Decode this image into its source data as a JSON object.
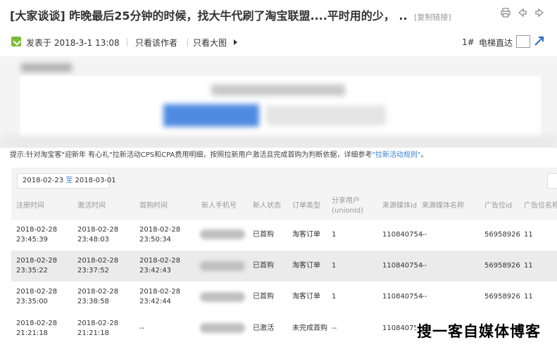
{
  "header": {
    "title_tag": "[大家谈谈]",
    "title": "昨晚最后25分钟的时候，找大牛代刷了淘宝联盟....平时用的少，",
    "title_ellipsis": "..",
    "copy_link": "[复制链接]",
    "icons": [
      "print-icon",
      "prev-icon",
      "next-icon"
    ]
  },
  "meta": {
    "posted": "发表于 2018-3-1 13:08",
    "only_author": "只看该作者",
    "big_image": "只看大图",
    "floor": "1#",
    "elevator": "电梯直达"
  },
  "notice": {
    "text": "提示:针对淘宝客\"迎新年 有心礼\"拉新活动CPS和CPA费用明细，按照拉新用户激活且完成首购为判断依据，详细参考",
    "link": "\"拉新活动规则\"",
    "end": "。"
  },
  "filter": {
    "date_from": "2018-02-23",
    "to": "至",
    "date_to": "2018-03-01"
  },
  "table": {
    "headers": {
      "reg_time": "注册时间",
      "act_time": "激活时间",
      "first_buy": "首购时间",
      "phone": "新人手机号",
      "status": "新人状态",
      "order_type": "订单类型",
      "share_user_1": "分享用户",
      "share_user_2": "(unionId)",
      "media_id": "来源媒体id",
      "media_name": "来源媒体名称",
      "adzone_id": "广告位id",
      "adzone_name": "广告位名称"
    },
    "rows": [
      {
        "reg_date": "2018-02-28",
        "reg_time": "23:45:39",
        "act_date": "2018-02-28",
        "act_time": "23:48:03",
        "buy_date": "2018-02-28",
        "buy_time": "23:50:34",
        "status": "已首购",
        "order": "淘客订单",
        "share": "1",
        "media_id": "110840754",
        "media_name": "--",
        "adzone_id": "56958926",
        "adzone_name": "11"
      },
      {
        "reg_date": "2018-02-28",
        "reg_time": "23:35:22",
        "act_date": "2018-02-28",
        "act_time": "23:37:52",
        "buy_date": "2018-02-28",
        "buy_time": "23:42:43",
        "status": "已首购",
        "order": "淘客订单",
        "share": "1",
        "media_id": "110840754",
        "media_name": "--",
        "adzone_id": "56958926",
        "adzone_name": "11"
      },
      {
        "reg_date": "2018-02-28",
        "reg_time": "23:35:00",
        "act_date": "2018-02-28",
        "act_time": "23:38:58",
        "buy_date": "2018-02-28",
        "buy_time": "23:42:44",
        "status": "已首购",
        "order": "淘客订单",
        "share": "1",
        "media_id": "110840754",
        "media_name": "--",
        "adzone_id": "56958926",
        "adzone_name": "11"
      },
      {
        "reg_date": "2018-02-28",
        "reg_time": "21:21:18",
        "act_date": "2018-02-28",
        "act_time": "21:21:18",
        "buy_date": "--",
        "buy_time": "",
        "status": "已激活",
        "order": "未完成首购",
        "share": "--",
        "media_id": "110840754",
        "media_name": "--",
        "adzone_id": "",
        "adzone_name": ""
      }
    ]
  },
  "watermark": "搜一客自媒体博客",
  "colors": {
    "link": "#3a7fd5",
    "avatar": "#7cbb3a",
    "row_alt": "#ebebeb"
  }
}
